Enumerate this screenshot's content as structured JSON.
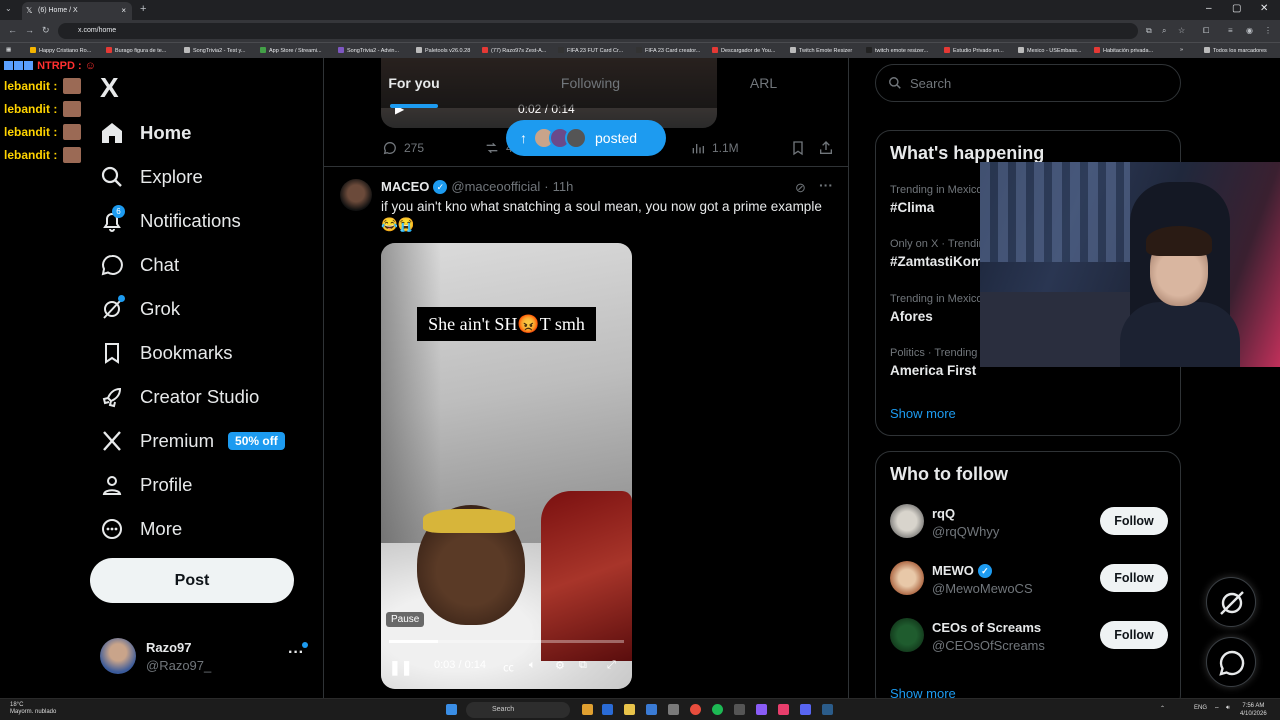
{
  "browser": {
    "tab_title": "(6) Home / X",
    "url": "x.com/home",
    "bookmarks": [
      "Happy Cristiano Ro...",
      "Burago figura de te...",
      "SongTrivia2 - Test y...",
      "App Store / Streami...",
      "SongTrivia2 - Advin...",
      "Paletools v26.0.28",
      "(77) Razo97s Zest-A...",
      "FIFA 23 FUT Card Cr...",
      "FIFA 23 Card creator...",
      "Descargador de You...",
      "Twitch Emote Resizer",
      "twitch emote resizer...",
      "Estudio Privado en...",
      "Mexico - USEmbass...",
      "Habitación privada..."
    ],
    "bookmarks_folder": "Todos los marcadores"
  },
  "overlay": {
    "header": "NTRPD :",
    "chat_user": "lebandit :"
  },
  "sidebar": {
    "logo": "X",
    "items": [
      {
        "label": "Home",
        "icon": "home-icon"
      },
      {
        "label": "Explore",
        "icon": "search-icon"
      },
      {
        "label": "Notifications",
        "icon": "bell-icon",
        "badge": "6"
      },
      {
        "label": "Chat",
        "icon": "chat-icon"
      },
      {
        "label": "Grok",
        "icon": "grok-icon"
      },
      {
        "label": "Bookmarks",
        "icon": "bookmark-icon"
      },
      {
        "label": "Creator Studio",
        "icon": "rocket-icon"
      },
      {
        "label": "Premium",
        "icon": "x-logo-icon",
        "badge": "50% off"
      },
      {
        "label": "Profile",
        "icon": "person-icon"
      },
      {
        "label": "More",
        "icon": "more-circle-icon"
      }
    ],
    "post_label": "Post",
    "account": {
      "name": "Razo97",
      "handle": "@Razo97_"
    }
  },
  "feed": {
    "tabs": [
      "For you",
      "Following",
      "ARL"
    ],
    "previous_media": {
      "time": "0:02 / 0:14"
    },
    "posted_pill": "posted",
    "previous_actions": {
      "replies": "275",
      "reposts": "4",
      "views": "1.1M"
    },
    "tweet": {
      "name": "MACEO",
      "handle": "@maceoofficial",
      "time": "11h",
      "text": "if you ain't kno what snatching a soul mean, you now got a prime example 😂😭",
      "video_caption": "She ain't SH😡T smh",
      "pause_tooltip": "Pause",
      "time_display": "0:03 / 0:14",
      "progress": 0.21
    }
  },
  "right": {
    "search_placeholder": "Search",
    "happening_title": "What's happening",
    "trends": [
      {
        "context": "Trending in Mexico",
        "title": "#Clima"
      },
      {
        "context": "Only on X · Trending",
        "title": "#ZamtastiKom"
      },
      {
        "context": "Trending in Mexico",
        "title": "Afores"
      },
      {
        "context": "Politics · Trending",
        "title": "America First"
      }
    ],
    "show_more": "Show more",
    "follow_title": "Who to follow",
    "follow": [
      {
        "name": "rqQ",
        "handle": "@rqQWhyy",
        "verified": false
      },
      {
        "name": "MEWO",
        "handle": "@MewoMewoCS",
        "verified": true
      },
      {
        "name": "CEOs of Screams",
        "handle": "@CEOsOfScreams",
        "verified": false
      }
    ],
    "follow_label": "Follow"
  },
  "taskbar": {
    "weather_temp": "18°C",
    "weather_desc": "Mayorm. nublado",
    "search": "Search",
    "lang": "ENG",
    "time": "7:56 AM",
    "date": "4/10/2026"
  }
}
